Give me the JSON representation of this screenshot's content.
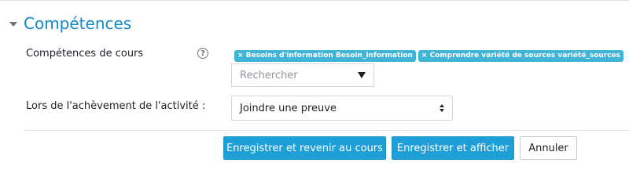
{
  "section": {
    "title": "Compétences"
  },
  "competencies": {
    "label": "Compétences de cours",
    "help_icon": "question-circle-icon",
    "tags": [
      "× Besoins d'information Besoin_information",
      "× Comprendre variété de sources variété_sources"
    ],
    "search_placeholder": "Rechercher"
  },
  "completion": {
    "label": "Lors de l'achèvement de l'activité :",
    "selected": "Joindre une preuve"
  },
  "buttons": {
    "save_return": "Enregistrer et revenir au cours",
    "save_display": "Enregistrer et afficher",
    "cancel": "Annuler"
  },
  "colors": {
    "accent": "#1289c7",
    "primary_button": "#1e9fd7",
    "tag": "#3fb4d6"
  }
}
